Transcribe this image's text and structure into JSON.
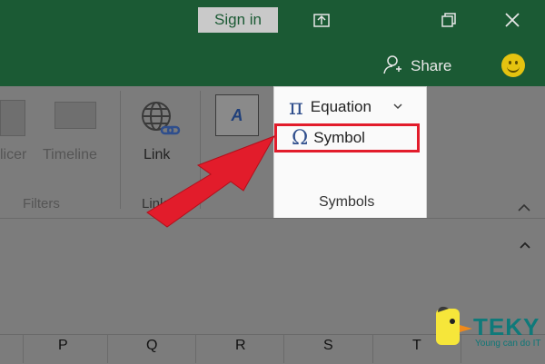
{
  "titlebar": {
    "sign_in": "Sign in",
    "share": "Share",
    "icons": [
      "restore-icon",
      "maximize-icon",
      "close-icon"
    ]
  },
  "ribbon": {
    "slicer": "licer",
    "timeline": "Timeline",
    "filters": "Filters",
    "link": "Link",
    "links": "Links",
    "text_icon": "A",
    "symbols_panel": {
      "equation": "Equation",
      "symbol": "Symbol",
      "group_label": "Symbols",
      "equation_icon": "π",
      "symbol_icon": "Ω"
    }
  },
  "columns": [
    "P",
    "Q",
    "R",
    "S",
    "T"
  ],
  "watermark": {
    "brand": "TEKY",
    "tagline": "Young can do IT"
  },
  "colors": {
    "titlebar_green": "#1b5a34",
    "highlight_red": "#e21c2b",
    "accent_blue": "#2f4e8c"
  }
}
